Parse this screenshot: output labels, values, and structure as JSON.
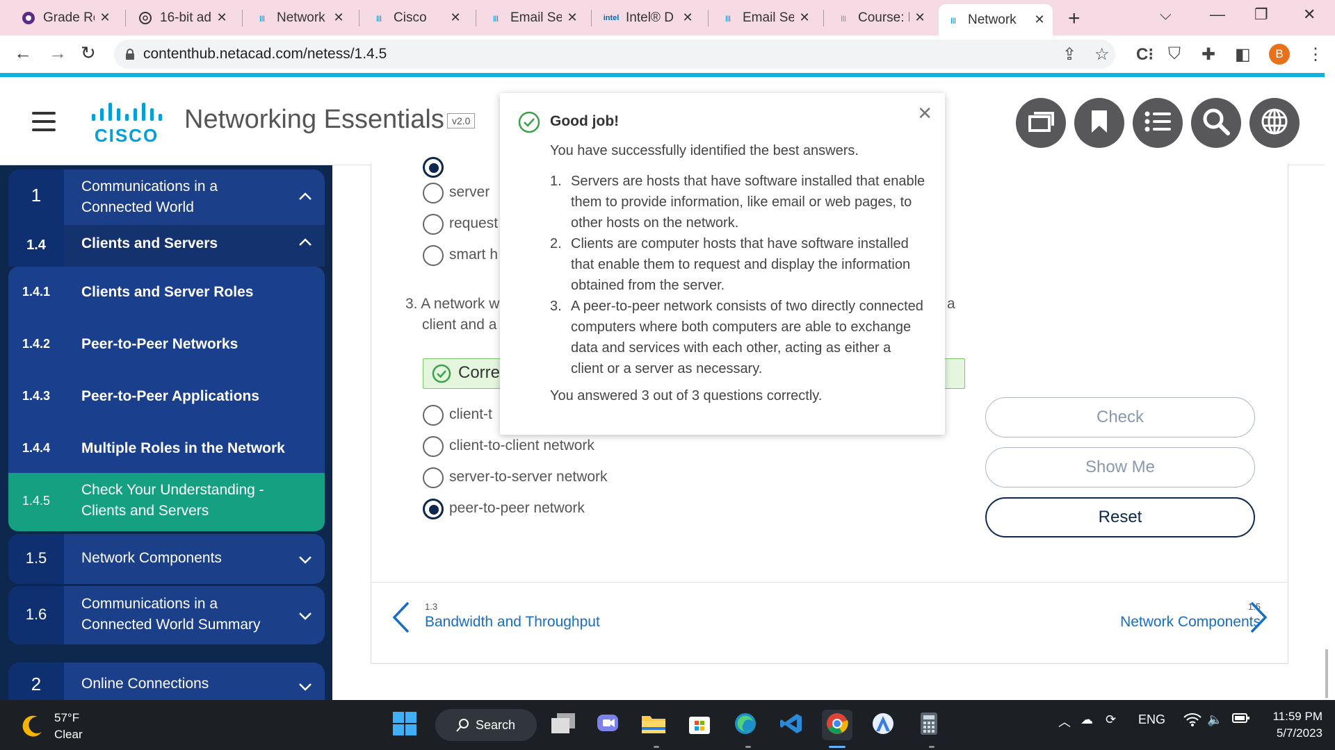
{
  "browser": {
    "tabs": [
      {
        "title": "Grade Re",
        "favicon": "grade-favicon"
      },
      {
        "title": "16-bit ad",
        "favicon": "chatgpt-favicon"
      },
      {
        "title": "Network",
        "favicon": "cisco-favicon"
      },
      {
        "title": "Cisco",
        "favicon": "cisco-favicon"
      },
      {
        "title": "Email Se",
        "favicon": "cisco-favicon"
      },
      {
        "title": "Intel® D",
        "favicon": "intel-favicon"
      },
      {
        "title": "Email Se",
        "favicon": "cisco-favicon"
      },
      {
        "title": "Course: F",
        "favicon": "cisco-favicon"
      },
      {
        "title": "Network",
        "favicon": "cisco-favicon",
        "active": true
      }
    ],
    "url": "contenthub.netacad.com/netess/1.4.5",
    "profile_initial": "B"
  },
  "header": {
    "logo_text": "CISCO",
    "course_title": "Networking Essentials",
    "version": "v2.0",
    "buttons": [
      "resources-icon",
      "bookmark-icon",
      "toc-icon",
      "search-icon",
      "globe-icon"
    ]
  },
  "sidebar": {
    "module1": {
      "num": "1",
      "label": "Communications in a Connected World"
    },
    "section14": {
      "num": "1.4",
      "label": "Clients and Servers"
    },
    "items": [
      {
        "num": "1.4.1",
        "label": "Clients and Server Roles"
      },
      {
        "num": "1.4.2",
        "label": "Peer-to-Peer Networks"
      },
      {
        "num": "1.4.3",
        "label": "Peer-to-Peer Applications"
      },
      {
        "num": "1.4.4",
        "label": "Multiple Roles in the Network"
      },
      {
        "num": "1.4.5",
        "label": "Check Your Understanding - Clients and Servers",
        "current": true
      }
    ],
    "section15": {
      "num": "1.5",
      "label": "Network Components"
    },
    "section16": {
      "num": "1.6",
      "label": "Communications in a Connected World Summary"
    },
    "module2": {
      "num": "2",
      "label": "Online Connections"
    }
  },
  "quiz": {
    "q2_options": [
      "server",
      "request",
      "smart h"
    ],
    "q3_text": "3. A network w",
    "q3_text_line2": "client and a",
    "q3_text_tail": "a",
    "correct_label": "Corre",
    "q3_options": [
      {
        "label": "client-t",
        "checked": false
      },
      {
        "label": "client-to-client network",
        "checked": false
      },
      {
        "label": "server-to-server network",
        "checked": false
      },
      {
        "label": "peer-to-peer network",
        "checked": true
      }
    ],
    "buttons": {
      "check": "Check",
      "show_me": "Show Me",
      "reset": "Reset"
    }
  },
  "pager": {
    "prev_num": "1.3",
    "prev_title": "Bandwidth and Throughput",
    "next_num": "1.5",
    "next_title": "Network Components"
  },
  "popup": {
    "title": "Good job!",
    "lead": "You have successfully identified the best answers.",
    "items": [
      "Servers are hosts that have software installed that enable them to provide information, like email or web pages, to other hosts on the network.",
      "Clients are computer hosts that have software installed that enable them to request and display the information obtained from the server.",
      "A peer-to-peer network consists of two directly connected computers where both computers are able to exchange data and services with each other, acting as either a client or a server as necessary."
    ],
    "score": "You answered 3 out of 3 questions correctly."
  },
  "taskbar": {
    "temp": "57°F",
    "condition": "Clear",
    "search_label": "Search",
    "language": "ENG",
    "time": "11:59 PM",
    "date": "5/7/2023"
  },
  "colors": {
    "sidebar_bg": "#0d274d",
    "sidebar_item": "#1c3f8a",
    "current_item": "#16a082",
    "accent_blue": "#0fb2e0",
    "link": "#166ec5"
  }
}
